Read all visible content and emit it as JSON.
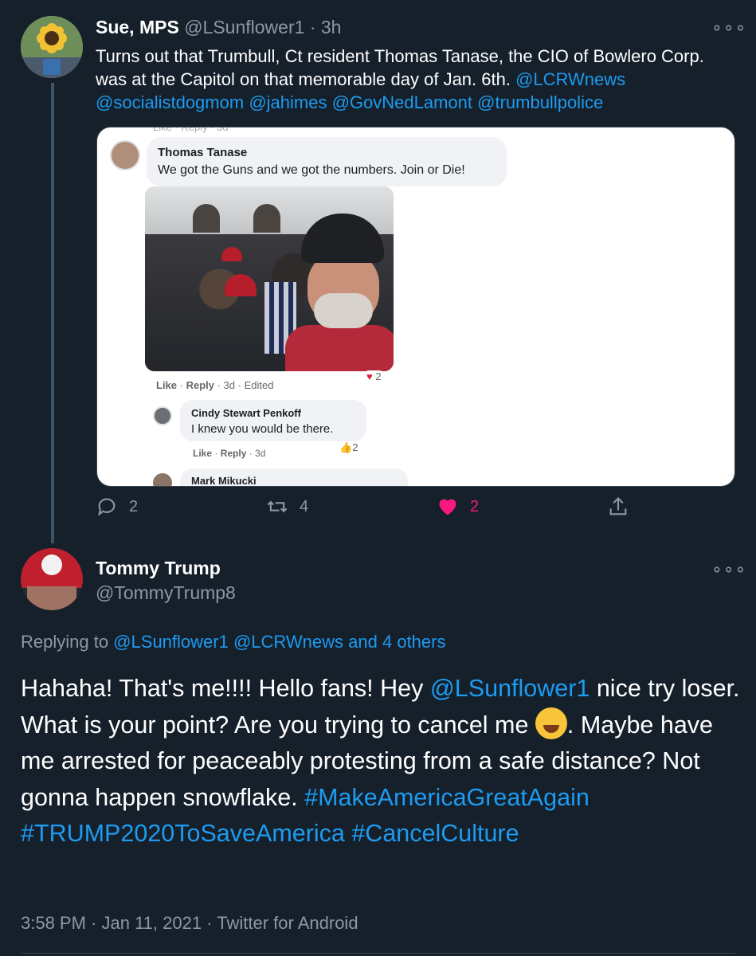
{
  "tweet1": {
    "name": "Sue, MPS",
    "handle": "@LSunflower1",
    "separator": "·",
    "time": "3h",
    "text_plain": "Turns out that Trumbull, Ct resident Thomas Tanase, the CIO of Bowlero Corp. was at the Capitol on that memorable day of Jan. 6th.",
    "mentions": [
      "@LCRWnews",
      "@socialistdogmom",
      "@jahimes",
      "@GovNedLamont",
      "@trumbullpolice"
    ],
    "actions": {
      "replies": "2",
      "retweets": "4",
      "likes": "2"
    },
    "embed": {
      "comment1_name": "Thomas Tanase",
      "comment1_text": "We got the Guns and we got the numbers. Join or Die!",
      "comment1_reactions": "2",
      "comment1_actions": {
        "like": "Like",
        "reply": "Reply",
        "time": "3d",
        "edited": "Edited"
      },
      "comment2_name": "Cindy Stewart Penkoff",
      "comment2_text": "I knew you would be there.",
      "comment2_reactions": "2",
      "comment2_actions": {
        "like": "Like",
        "reply": "Reply",
        "time": "3d"
      },
      "comment3_name": "Mark Mikucki"
    }
  },
  "tweet2": {
    "name": "Tommy Trump",
    "handle": "@TommyTrump8",
    "replying_label": "Replying to",
    "replying_mentions": [
      "@LSunflower1",
      "@LCRWnews"
    ],
    "replying_others": "and 4 others",
    "text_1": "Hahaha! That's me!!!! Hello fans! Hey ",
    "text_mention": "@LSunflower1",
    "text_2": " nice try loser. What is your point? Are you trying to cancel me ",
    "text_3": ". Maybe have me arrested for peaceably protesting from a safe distance? Not gonna happen snowflake.",
    "hashtags": [
      "#MakeAmericaGreatAgain",
      "#TRUMP2020ToSaveAmerica",
      "#CancelCulture"
    ],
    "time": "3:58 PM",
    "date": "Jan 11, 2021",
    "source": "Twitter for Android"
  },
  "icons": [
    "more-icon",
    "reply-icon",
    "retweet-icon",
    "heart-icon",
    "share-icon"
  ],
  "colors": {
    "background": "#15202b",
    "link": "#1d9bf0",
    "muted": "#8b98a5",
    "like": "#f91880"
  }
}
